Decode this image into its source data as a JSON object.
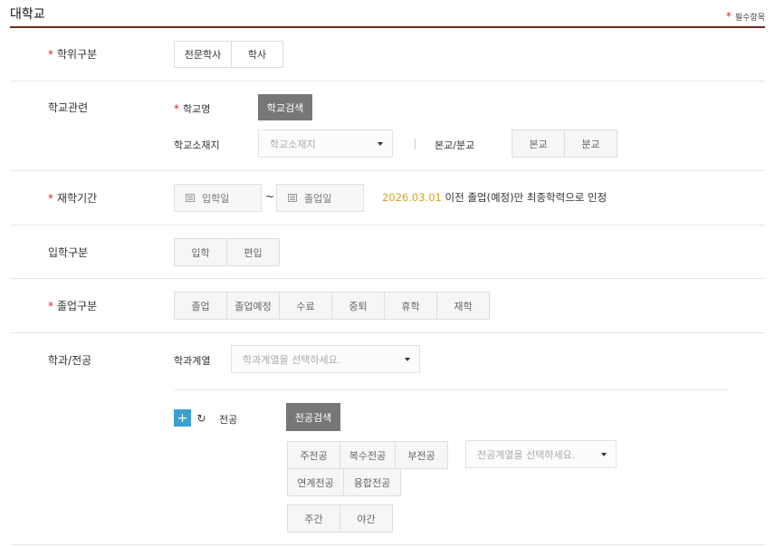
{
  "title": "대학교",
  "required_note": "필수항목",
  "required_mark": "*",
  "degree": {
    "label": "학위구분",
    "options": [
      "전문학사",
      "학사"
    ]
  },
  "school": {
    "label": "학교관련",
    "name_label": "학교명",
    "search_button": "학교검색",
    "location_label": "학교소재지",
    "location_placeholder": "학교소재지",
    "campus_label": "본교/분교",
    "campus_options": [
      "본교",
      "분교"
    ]
  },
  "period": {
    "label": "재학기간",
    "start_placeholder": "입학일",
    "separator": "~",
    "end_placeholder": "졸업일",
    "hint_date": "2026.03.01",
    "hint_text": " 이전 졸업(예정)만 최종학력으로 인정"
  },
  "entrance": {
    "label": "입학구분",
    "options": [
      "입학",
      "편입"
    ]
  },
  "graduation": {
    "label": "졸업구분",
    "options": [
      "졸업",
      "졸업예정",
      "수료",
      "중퇴",
      "휴학",
      "재학"
    ]
  },
  "major": {
    "label": "학과/전공",
    "dept_label": "학과계열",
    "dept_placeholder": "학과계열을 선택하세요.",
    "plus": "+",
    "reset": "↻",
    "major_label": "전공",
    "search_button": "전공검색",
    "type_options_row1": [
      "주전공",
      "복수전공",
      "부전공"
    ],
    "type_options_row2": [
      "연계전공",
      "융합전공"
    ],
    "major_dept_placeholder": "전공계열을 선택하세요.",
    "time_options": [
      "주간",
      "야간"
    ]
  }
}
